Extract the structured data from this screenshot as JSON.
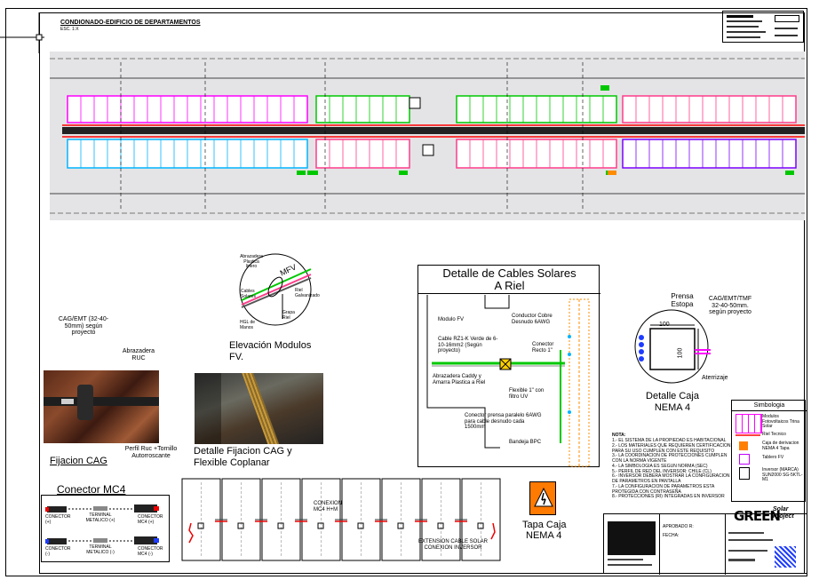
{
  "sheet": {
    "title": "CONDIONADO-EDIFICIO DE DEPARTAMENTOS",
    "scale": "ESC. 1:X"
  },
  "elevation": {
    "title": "Elevación Modulos FV.",
    "labels": {
      "abrazadera": "Abrazadera Plastica linero",
      "mfv": "MFV",
      "cables": "Cables Solares",
      "riel": "Riel Galvanizado",
      "grapa": "Grapa Riel",
      "hgl": "HGL de Manos"
    }
  },
  "cables_detail": {
    "title_line1": "Detalle de Cables Solares",
    "title_line2": "A Riel",
    "labels": {
      "modulo": "Modulo FV",
      "conductor_cobre": "Conductor Cobre Desnudo 6AWG",
      "conector_recto": "Conector Recto 1\"",
      "cable_rz1": "Cable RZ1-K Verde de 6-10-16mm2 (Según proyecto)",
      "abrazadera": "Abrazadera Caddy y Amarra Plastica a Riel",
      "flexible": "Flexible 1\" con filtro UV",
      "conector_prensa": "Conector prensa paralelo 6AWG para cable desnudo cada 1500mm",
      "bandeja": "Bandeja BPC"
    }
  },
  "caja_detail": {
    "title_line1": "Detalle Caja",
    "title_line2": "NEMA 4",
    "prensa": "Prensa Estopa",
    "cag": "CAG/EMT/TMF 32-40-50mm. según proyecto",
    "dim_w": "100",
    "dim_h": "100",
    "aterrizaje": "Aterrizaje"
  },
  "fijacion_cag": {
    "cag_note": "CAG/EMT (32-40-50mm) según proyecto",
    "abrazadera": "Abrazadera RUC",
    "perfil": "Perfil Ruc +Tornillo Autorroscante",
    "title": "Fijacion CAG"
  },
  "fijacion_flex": {
    "title_line1": "Detalle Fijacion CAG y",
    "title_line2": "Flexible Coplanar"
  },
  "conector_mc4": {
    "title": "Conector MC4",
    "labels": [
      "CONECTOR (+)",
      "TERMINAL METALICO (+)",
      "CONECTOR MC4 (+)",
      "CONECTOR (-)",
      "TERMINAL METALICO (-)",
      "CONECTOR MC4 (-)"
    ]
  },
  "modules_strip": {
    "union": "CONEXION MC4 H+M",
    "extension": "EXTENSION CABLE SOLAR CONEXION INVERSOR"
  },
  "tapa_caja": {
    "title_line1": "Tapa Caja",
    "title_line2": "NEMA 4"
  },
  "notes": {
    "heading": "NOTA:",
    "lines": [
      "1.- EL SISTEMA DE LA PROPIEDAD ES HABITACIONAL",
      "2.- LOS MATERIALES QUE REQUIEREN CERTIFICACION PARA SU USO CUMPLEN CON ESTE REQUISITO",
      "3.- LA COORDINACION DE PROTECCIONES CUMPLEN CON LA NORMA VIGENTE",
      "4.- LA SIMBOLOGIA ES SEGUN NORMA (SEC)",
      "5.- PERFIL DE RED DEL INVERSOR: CHILE (CL)",
      "6.- INVERSOR DEBERA MOSTRAR LA CONFIGURACION DE PARAMETROS EN PANTALLA",
      "7.- LA CONFIGURACION DE PARAMETROS ESTA PROTEGIDA CON CONTRASEÑA",
      "8.- PROTECCIONES (RI) INTEGRADAS EN INVERSOR"
    ]
  },
  "legend": {
    "title": "Simbologia",
    "items": [
      {
        "label": "Modulos Fotovoltaicos Trina Solar",
        "color": "#ff00ff"
      },
      {
        "label": "Riel Tecnico",
        "color": "#ff4040"
      },
      {
        "label": "Caja de derivacion NEMA 4 Tapa",
        "color": "#ff8000"
      },
      {
        "label": "Tablero FV",
        "color": "#c000ff"
      },
      {
        "label": "Inversor (MARCA) SUN2000 SG-5KTL-M1",
        "color": "#000000"
      }
    ]
  },
  "brand": {
    "name": "GREEN",
    "sub": "Solar Project"
  },
  "titleblock": {
    "rows": [
      "APROBADO R:",
      "FECHA:"
    ]
  },
  "colors": {
    "magenta": "#ff00ff",
    "pink": "#ff3c8a",
    "green": "#00c800",
    "cyan": "#00b4ff",
    "red": "#ff0000",
    "purple": "#7a00ff",
    "orange": "#ff8c00"
  }
}
